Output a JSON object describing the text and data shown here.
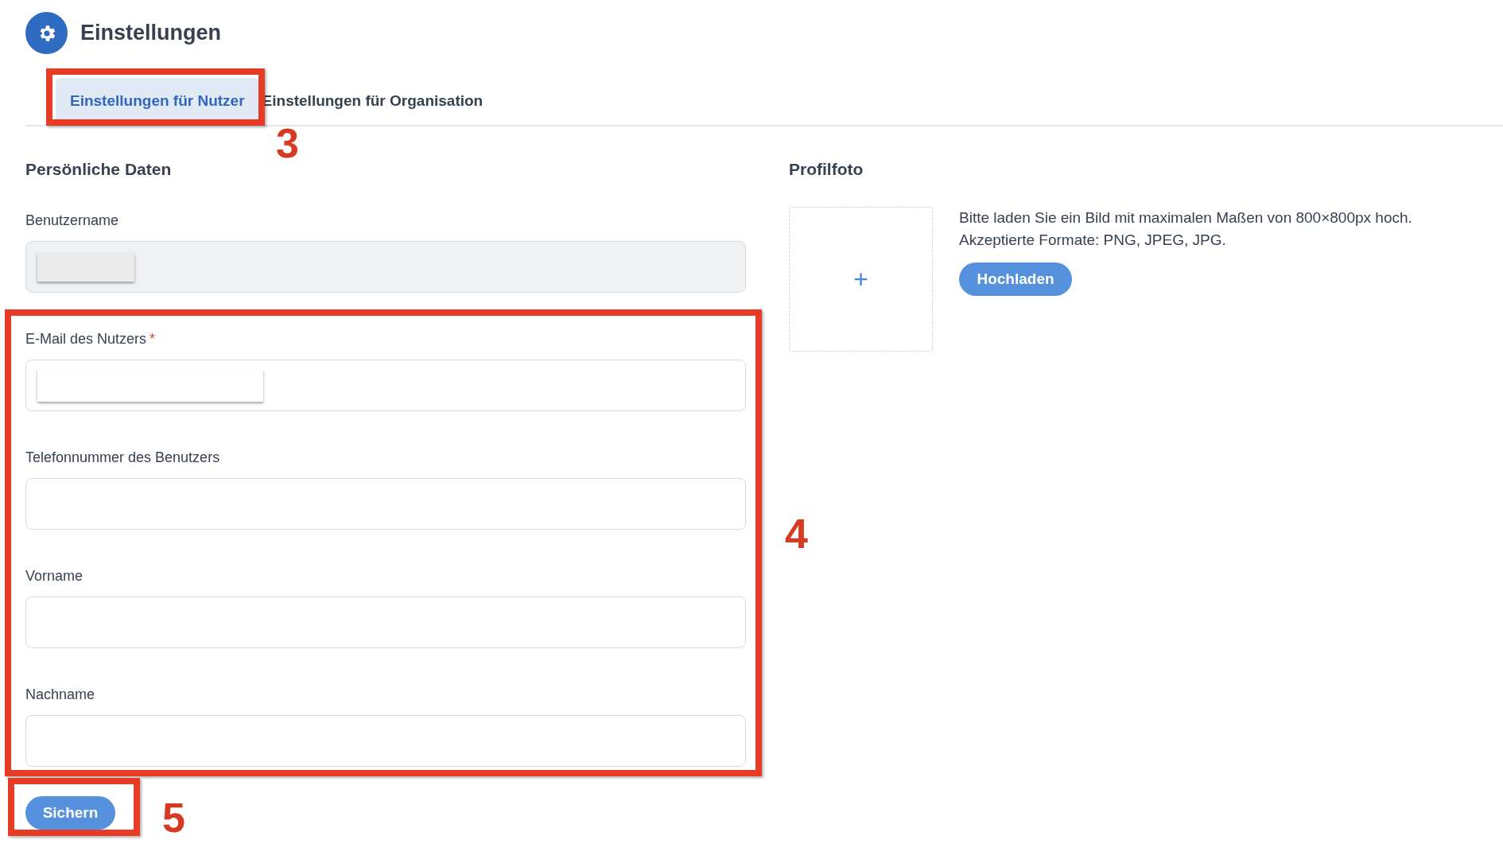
{
  "header": {
    "title": "Einstellungen"
  },
  "tabs": [
    {
      "label": "Einstellungen für Nutzer",
      "selected": true
    },
    {
      "label": "Einstellungen für Organisation",
      "selected": false
    }
  ],
  "personal_data": {
    "heading": "Persönliche Daten",
    "fields": [
      {
        "label": "Benutzername",
        "disabled": true,
        "redacted": true
      },
      {
        "label": "E-Mail des Nutzers",
        "required_mark": "*",
        "disabled": false,
        "redacted": true
      },
      {
        "label": "Telefonnummer des Benutzers",
        "disabled": false,
        "redacted": false
      },
      {
        "label": "Vorname",
        "disabled": false,
        "redacted": false
      },
      {
        "label": "Nachname",
        "disabled": false,
        "redacted": false
      }
    ],
    "save_button": "Sichern"
  },
  "profile_photo": {
    "heading": "Profilfoto",
    "add_symbol": "+",
    "hint_lines": [
      "Bitte laden Sie ein Bild mit maximalen Maßen von 800×800px hoch.",
      "Akzeptierte Formate: PNG, JPEG, JPG."
    ],
    "upload_button": "Hochladen"
  },
  "annotations": [
    {
      "label": "3"
    },
    {
      "label": "4"
    },
    {
      "label": "5"
    }
  ]
}
